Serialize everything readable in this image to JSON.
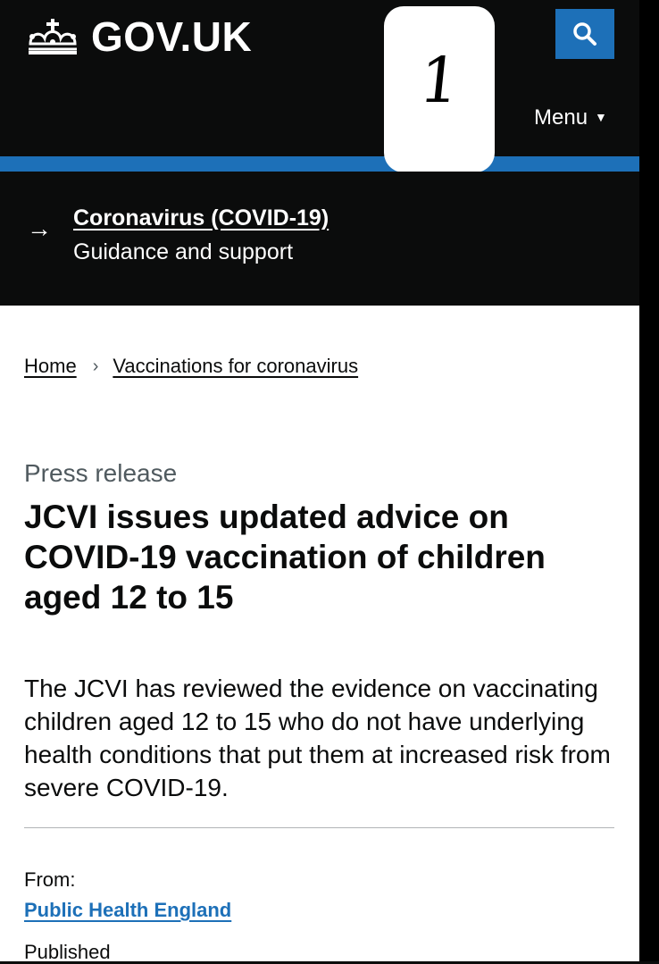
{
  "header": {
    "logo_text": "GOV.UK",
    "menu_label": "Menu",
    "menu_caret": "▼",
    "search_icon": "search-icon",
    "crown_icon": "crown-icon"
  },
  "overlay_badge": {
    "label": "1"
  },
  "covid_banner": {
    "arrow": "→",
    "title": "Coronavirus (COVID-19)",
    "subtitle": "Guidance and support"
  },
  "breadcrumb": {
    "items": [
      "Home",
      "Vaccinations for coronavirus"
    ],
    "separator": "›"
  },
  "article": {
    "caption": "Press release",
    "title": "JCVI issues updated advice on COVID-19 vaccination of children aged 12 to 15",
    "lead": "The JCVI has reviewed the evidence on vaccinating children aged 12 to 15 who do not have underlying health conditions that put them at increased risk from severe COVID-19.",
    "from_label": "From:",
    "from_org": "Public Health England",
    "published_label": "Published"
  },
  "colors": {
    "header_bg": "#0b0c0c",
    "brand_blue": "#1d70b8",
    "text": "#0b0c0c",
    "secondary_text": "#505a5f"
  }
}
